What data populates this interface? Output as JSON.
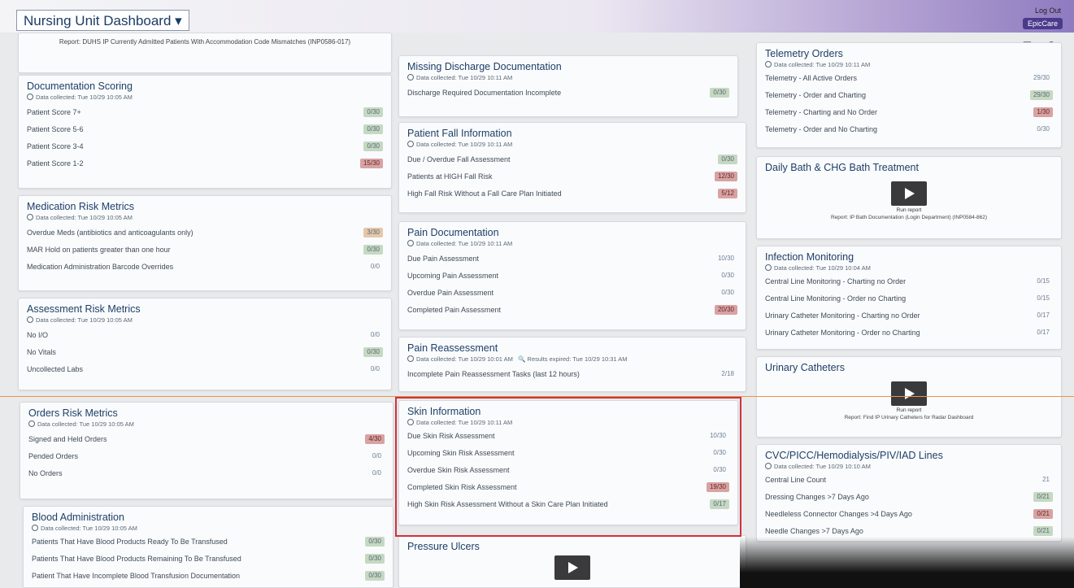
{
  "header": {
    "title": "Nursing Unit Dashboard ▾",
    "logout": "Log Out",
    "epic": "EpicCare"
  },
  "report_top": {
    "text": "Report: DUHS IP Currently Admitted Patients With Accommodation Code Mismatches (INP0586-017)"
  },
  "doc_scoring": {
    "title": "Documentation Scoring",
    "collected": "Data collected: Tue 10/29 10:05 AM",
    "rows": [
      {
        "label": "Patient Score 7+",
        "value": "0/30",
        "status": "green"
      },
      {
        "label": "Patient Score 5-6",
        "value": "0/30",
        "status": "green"
      },
      {
        "label": "Patient Score 3-4",
        "value": "0/30",
        "status": "green"
      },
      {
        "label": "Patient Score 1-2",
        "value": "15/30",
        "status": "red"
      }
    ]
  },
  "med_risk": {
    "title": "Medication Risk Metrics",
    "collected": "Data collected: Tue 10/29 10:05 AM",
    "rows": [
      {
        "label": "Overdue Meds (antibiotics and anticoagulants only)",
        "value": "3/30",
        "status": "amber"
      },
      {
        "label": "MAR Hold on patients greater than one hour",
        "value": "0/30",
        "status": "green"
      },
      {
        "label": "Medication Administration Barcode Overrides",
        "value": "0/0",
        "status": "plain"
      }
    ]
  },
  "assessment_risk": {
    "title": "Assessment Risk Metrics",
    "collected": "Data collected: Tue 10/29 10:05 AM",
    "rows": [
      {
        "label": "No I/O",
        "value": "0/0",
        "status": "plain"
      },
      {
        "label": "No Vitals",
        "value": "0/30",
        "status": "green"
      },
      {
        "label": "Uncollected Labs",
        "value": "0/0",
        "status": "plain"
      }
    ]
  },
  "orders_risk": {
    "title": "Orders Risk Metrics",
    "collected": "Data collected: Tue 10/29 10:05 AM",
    "rows": [
      {
        "label": "Signed and Held Orders",
        "value": "4/30",
        "status": "red"
      },
      {
        "label": "Pended Orders",
        "value": "0/0",
        "status": "plain"
      },
      {
        "label": "No Orders",
        "value": "0/0",
        "status": "plain"
      }
    ]
  },
  "blood_admin": {
    "title": "Blood Administration",
    "collected": "Data collected: Tue 10/29 10:05 AM",
    "rows": [
      {
        "label": "Patients That Have Blood Products Ready To Be Transfused",
        "value": "0/30",
        "status": "green"
      },
      {
        "label": "Patients That Have Blood Products Remaining To Be Transfused",
        "value": "0/30",
        "status": "green"
      },
      {
        "label": "Patient That Have Incomplete Blood Transfusion Documentation",
        "value": "0/30",
        "status": "green"
      }
    ]
  },
  "missing_discharge": {
    "title": "Missing Discharge Documentation",
    "collected": "Data collected: Tue 10/29 10:11 AM",
    "rows": [
      {
        "label": "Discharge Required Documentation Incomplete",
        "value": "0/30",
        "status": "green"
      }
    ]
  },
  "fall_info": {
    "title": "Patient Fall Information",
    "collected": "Data collected: Tue 10/29 10:11 AM",
    "rows": [
      {
        "label": "Due / Overdue Fall Assessment",
        "value": "0/30",
        "status": "green"
      },
      {
        "label": "Patients at HIGH Fall Risk",
        "value": "12/30",
        "status": "red"
      },
      {
        "label": "High Fall Risk Without a Fall Care Plan Initiated",
        "value": "5/12",
        "status": "red"
      }
    ]
  },
  "pain_doc": {
    "title": "Pain Documentation",
    "collected": "Data collected: Tue 10/29 10:11 AM",
    "rows": [
      {
        "label": "Due Pain Assessment",
        "value": "10/30",
        "status": "plain"
      },
      {
        "label": "Upcoming Pain Assessment",
        "value": "0/30",
        "status": "plain"
      },
      {
        "label": "Overdue Pain Assessment",
        "value": "0/30",
        "status": "plain"
      },
      {
        "label": "Completed Pain Assessment",
        "value": "20/30",
        "status": "red"
      }
    ]
  },
  "pain_reassess": {
    "title": "Pain Reassessment",
    "collected": "Data collected: Tue 10/29 10:01 AM",
    "expired": "Results expired: Tue 10/29 10:31 AM",
    "rows": [
      {
        "label": "Incomplete Pain Reassessment Tasks (last 12 hours)",
        "value": "2/18",
        "status": "plain"
      }
    ]
  },
  "skin_info": {
    "title": "Skin Information",
    "collected": "Data collected: Tue 10/29 10:11 AM",
    "rows": [
      {
        "label": "Due Skin Risk Assessment",
        "value": "10/30",
        "status": "plain"
      },
      {
        "label": "Upcoming Skin Risk Assessment",
        "value": "0/30",
        "status": "plain"
      },
      {
        "label": "Overdue Skin Risk Assessment",
        "value": "0/30",
        "status": "plain"
      },
      {
        "label": "Completed Skin Risk Assessment",
        "value": "19/30",
        "status": "red"
      },
      {
        "label": "High Skin Risk Assessment Without a Skin Care Plan Initiated",
        "value": "0/17",
        "status": "green"
      }
    ]
  },
  "pressure_ulcers": {
    "title": "Pressure Ulcers"
  },
  "telemetry": {
    "title": "Telemetry Orders",
    "collected": "Data collected: Tue 10/29 10:11 AM",
    "rows": [
      {
        "label": "Telemetry - All Active Orders",
        "value": "29/30",
        "status": "plain"
      },
      {
        "label": "Telemetry - Order and Charting",
        "value": "29/30",
        "status": "green"
      },
      {
        "label": "Telemetry - Charting and No Order",
        "value": "1/30",
        "status": "red"
      },
      {
        "label": "Telemetry - Order and No Charting",
        "value": "0/30",
        "status": "plain"
      }
    ]
  },
  "daily_bath": {
    "title": "Daily Bath & CHG Bath Treatment",
    "run": "Run report",
    "report": "Report: IP Bath Documentation (Login Department) (INP0584-862)"
  },
  "infection": {
    "title": "Infection Monitoring",
    "collected": "Data collected: Tue 10/29 10:04 AM",
    "rows": [
      {
        "label": "Central Line Monitoring - Charting no Order",
        "value": "0/15",
        "status": "plain"
      },
      {
        "label": "Central Line Monitoring - Order no Charting",
        "value": "0/15",
        "status": "plain"
      },
      {
        "label": "Urinary Catheter Monitoring - Charting no Order",
        "value": "0/17",
        "status": "plain"
      },
      {
        "label": "Urinary Catheter Monitoring - Order no Charting",
        "value": "0/17",
        "status": "plain"
      }
    ]
  },
  "urinary": {
    "title": "Urinary Catheters",
    "run": "Run report",
    "report": "Report: Find IP Urinary Catheters for Radar Dashboard"
  },
  "cvc": {
    "title": "CVC/PICC/Hemodialysis/PIV/IAD Lines",
    "collected": "Data collected: Tue 10/29 10:10 AM",
    "rows": [
      {
        "label": "Central Line Count",
        "value": "21",
        "status": "plain"
      },
      {
        "label": "Dressing Changes >7 Days Ago",
        "value": "0/21",
        "status": "green"
      },
      {
        "label": "Needleless Connector Changes >4 Days Ago",
        "value": "0/21",
        "status": "red"
      },
      {
        "label": "Needle Changes >7 Days Ago",
        "value": "0/21",
        "status": "green"
      }
    ]
  }
}
